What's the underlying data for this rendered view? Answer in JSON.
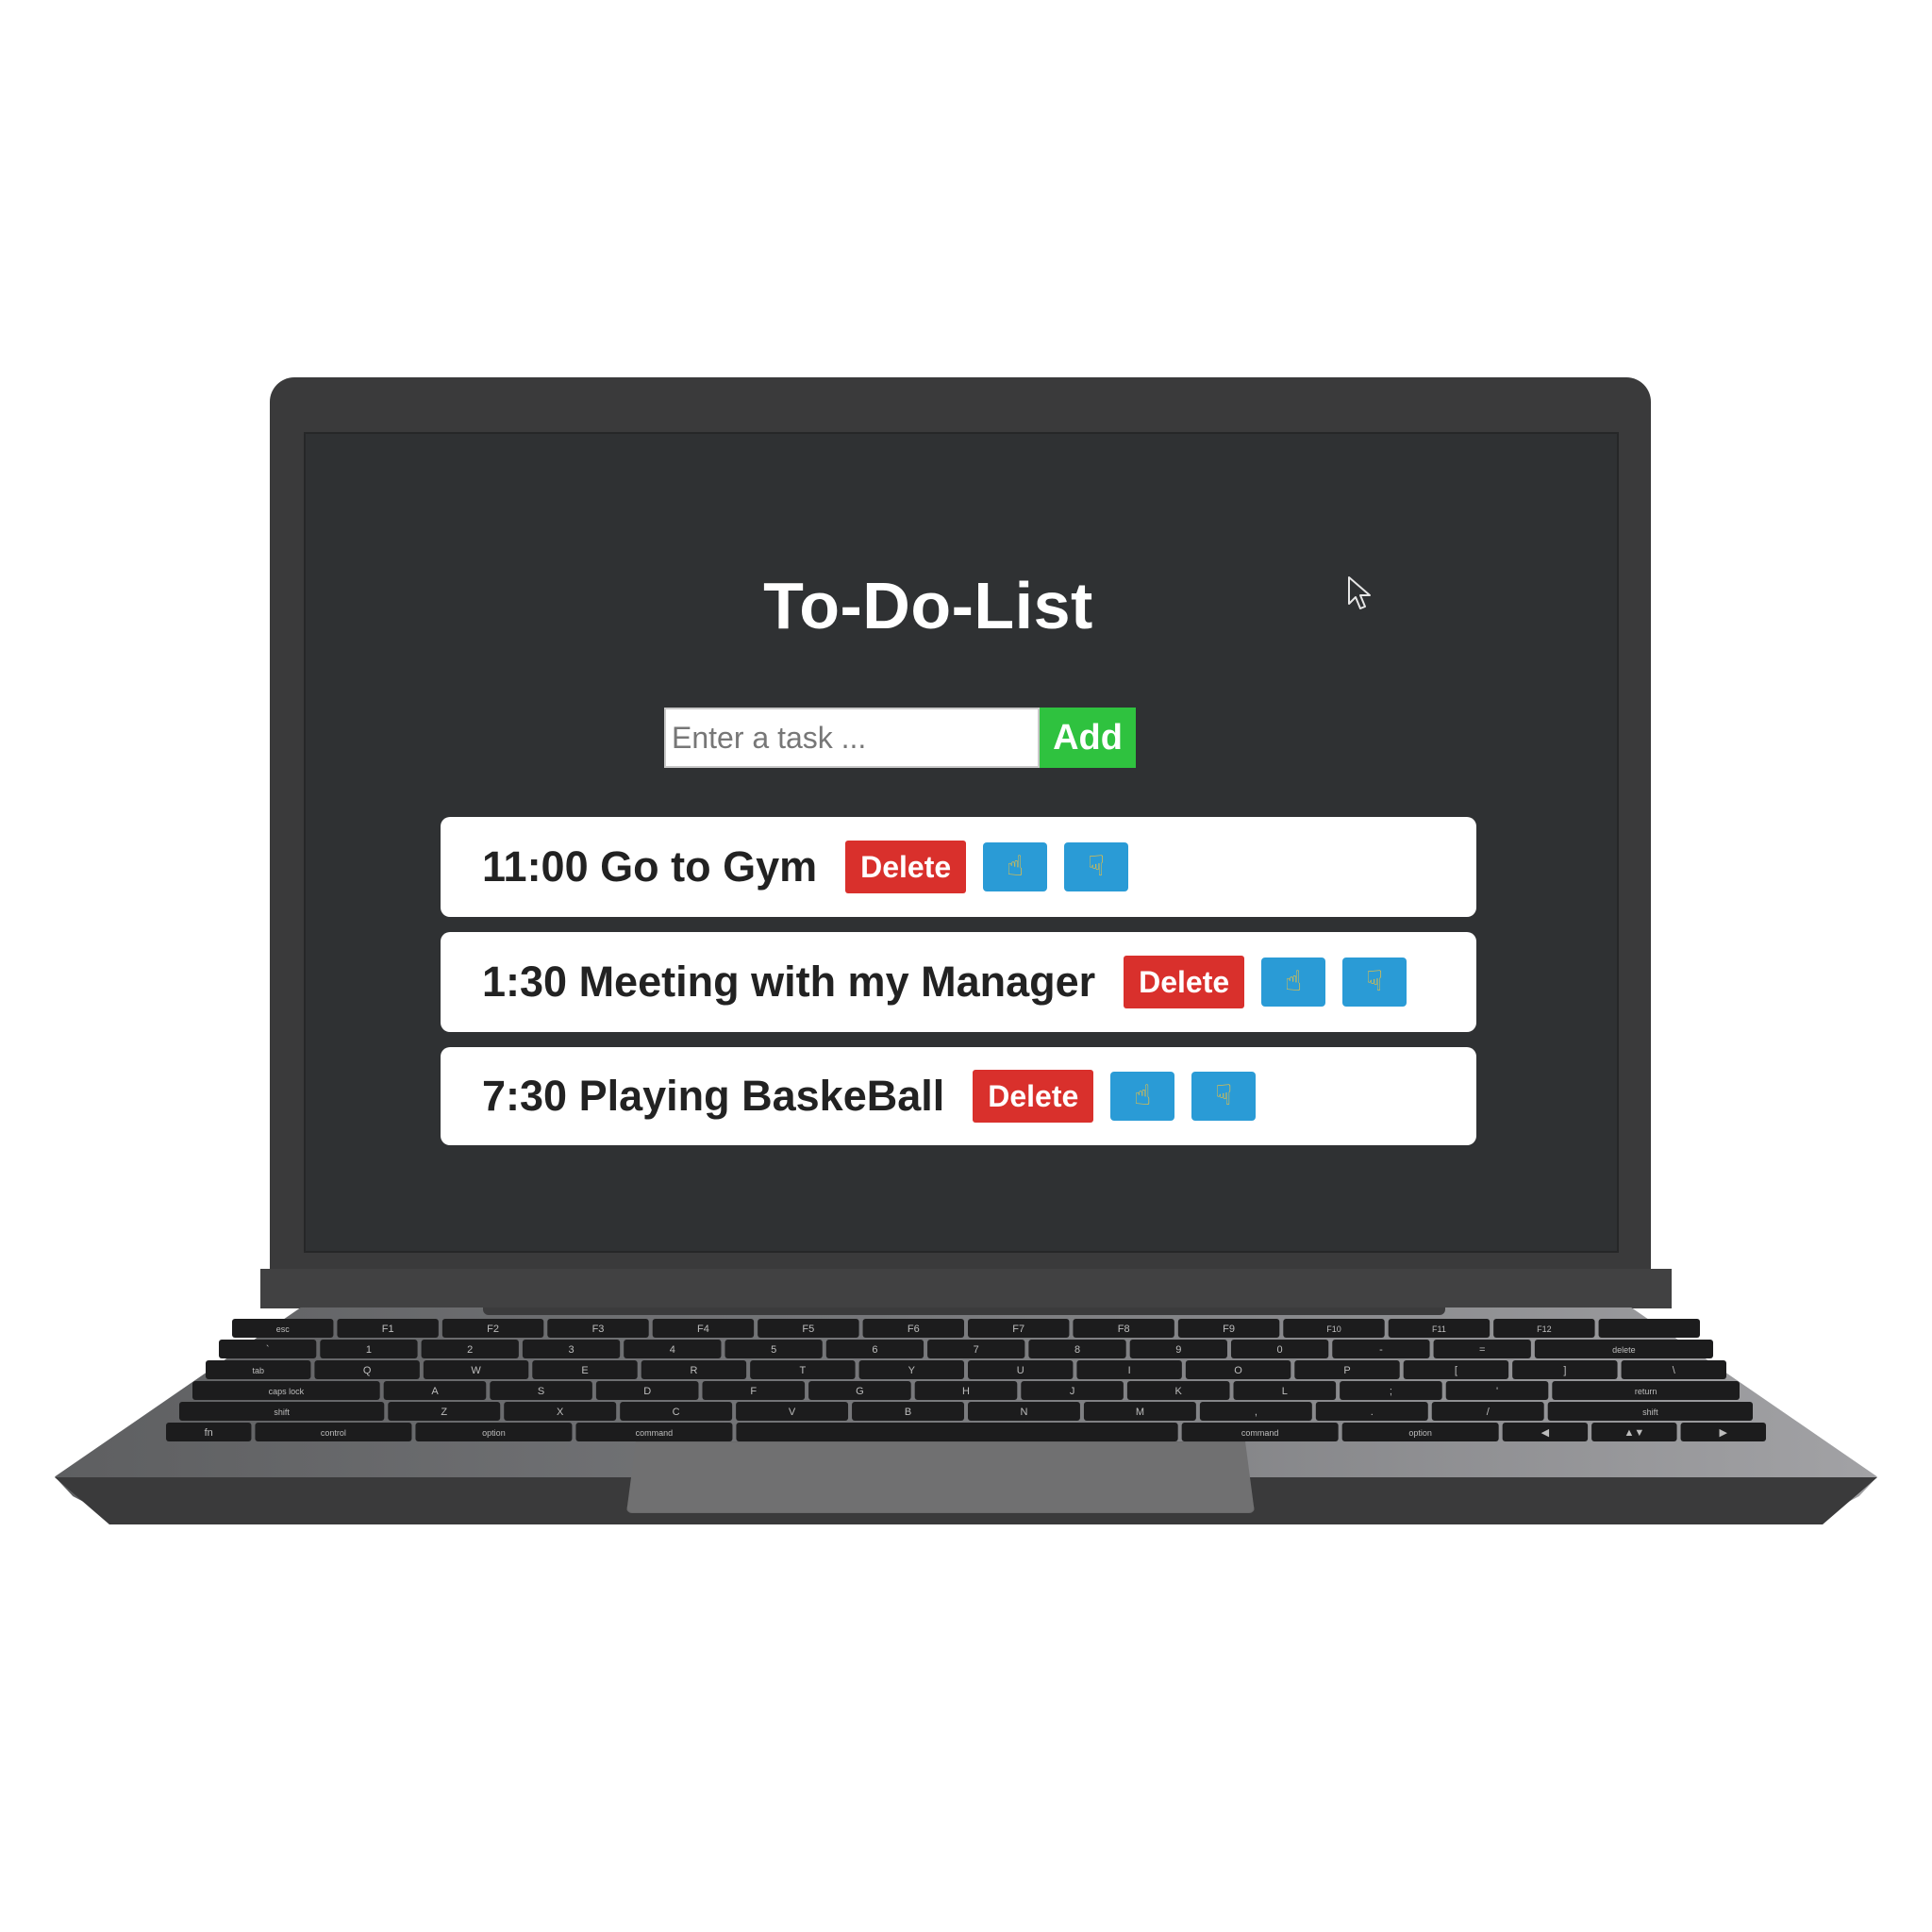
{
  "app": {
    "title": "To-Do-List",
    "input_placeholder": "Enter a task ...",
    "add_label": "Add"
  },
  "tasks": [
    {
      "text": "11:00 Go to Gym",
      "delete_label": "Delete",
      "up_icon": "pointing-up-hand-icon",
      "down_icon": "pointing-down-hand-icon"
    },
    {
      "text": "1:30 Meeting with my Manager",
      "delete_label": "Delete",
      "up_icon": "pointing-up-hand-icon",
      "down_icon": "pointing-down-hand-icon"
    },
    {
      "text": "7:30 Playing BaskeBall",
      "delete_label": "Delete",
      "up_icon": "pointing-up-hand-icon",
      "down_icon": "pointing-down-hand-icon"
    }
  ],
  "colors": {
    "screen_bg": "#2f3133",
    "add_button": "#2fc23f",
    "delete_button": "#d9302c",
    "move_button": "#2a9bd6",
    "hand_icon": "#f3c13a"
  },
  "keyboard": {
    "rows": [
      [
        "esc",
        "F1",
        "F2",
        "F3",
        "F4",
        "F5",
        "F6",
        "F7",
        "F8",
        "F9",
        "F10",
        "F11",
        "F12",
        ""
      ],
      [
        "`",
        "1",
        "2",
        "3",
        "4",
        "5",
        "6",
        "7",
        "8",
        "9",
        "0",
        "-",
        "=",
        "delete"
      ],
      [
        "tab",
        "Q",
        "W",
        "E",
        "R",
        "T",
        "Y",
        "U",
        "I",
        "O",
        "P",
        "[",
        "]",
        "\\"
      ],
      [
        "caps lock",
        "A",
        "S",
        "D",
        "F",
        "G",
        "H",
        "J",
        "K",
        "L",
        ";",
        "'",
        "return"
      ],
      [
        "shift",
        "Z",
        "X",
        "C",
        "V",
        "B",
        "N",
        "M",
        ",",
        ".",
        "/",
        "shift"
      ],
      [
        "fn",
        "control",
        "option",
        "command",
        "",
        "command",
        "option",
        "◀",
        "▲▼",
        "▶"
      ]
    ]
  }
}
